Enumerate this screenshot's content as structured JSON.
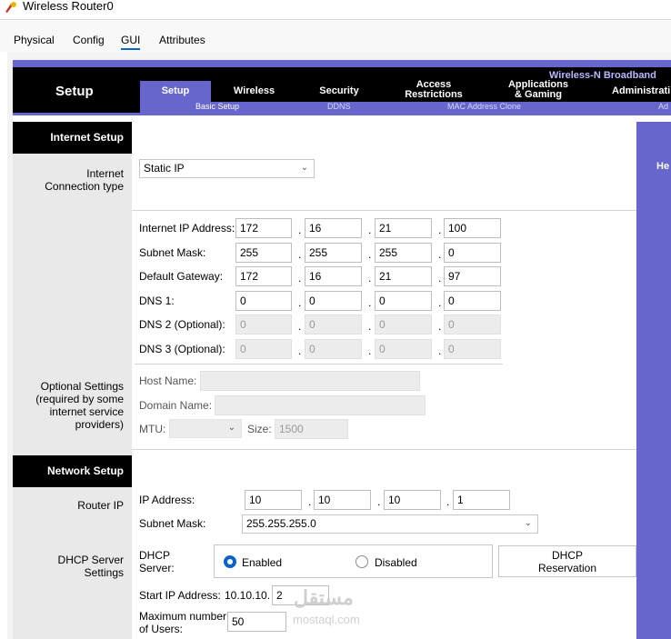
{
  "window": {
    "title": "Wireless Router0"
  },
  "top_tabs": [
    "Physical",
    "Config",
    "GUI",
    "Attributes"
  ],
  "header": {
    "brand": "Wireless-N Broadband",
    "section_title": "Setup",
    "nav": {
      "setup": "Setup",
      "wireless": "Wireless",
      "security": "Security",
      "access_1": "Access",
      "access_2": "Restrictions",
      "apps_1": "Applications",
      "apps_2": "& Gaming",
      "admin": "Administrati"
    },
    "subnav": {
      "basic": "Basic Setup",
      "ddns": "DDNS",
      "mac": "MAC Address Clone",
      "ad": "Ad"
    }
  },
  "help_label": "He",
  "internet_setup": {
    "section": "Internet Setup",
    "conn_label_1": "Internet",
    "conn_label_2": "Connection type",
    "conn_type": "Static IP",
    "ip_label": "Internet IP Address:",
    "ip": [
      "172",
      "16",
      "21",
      "100"
    ],
    "mask_label": "Subnet Mask:",
    "mask": [
      "255",
      "255",
      "255",
      "0"
    ],
    "gw_label": "Default Gateway:",
    "gw": [
      "172",
      "16",
      "21",
      "97"
    ],
    "dns1_label": "DNS 1:",
    "dns1": [
      "0",
      "0",
      "0",
      "0"
    ],
    "dns2_label": "DNS 2 (Optional):",
    "dns2": [
      "0",
      "0",
      "0",
      "0"
    ],
    "dns3_label": "DNS 3 (Optional):",
    "dns3": [
      "0",
      "0",
      "0",
      "0"
    ],
    "opt_1": "Optional Settings",
    "opt_2": "(required by some",
    "opt_3": "internet service",
    "opt_4": "providers)",
    "host_label": "Host Name:",
    "domain_label": "Domain Name:",
    "mtu_label": "MTU:",
    "size_label": "Size:",
    "size_value": "1500"
  },
  "network_setup": {
    "section": "Network Setup",
    "router_ip_label": "Router IP",
    "ip_label": "IP Address:",
    "ip": [
      "10",
      "10",
      "10",
      "1"
    ],
    "mask_label": "Subnet Mask:",
    "mask": "255.255.255.0",
    "dhcp_l1": "DHCP Server",
    "dhcp_l2": "Settings",
    "dhcp_server_1": "DHCP",
    "dhcp_server_2": "Server:",
    "enabled": "Enabled",
    "disabled": "Disabled",
    "reservation_1": "DHCP",
    "reservation_2": "Reservation",
    "start_label": "Start IP Address:",
    "start_prefix": "10.10.10.",
    "start_value": "2",
    "max_1": "Maximum number",
    "max_2": "of Users:",
    "max_value": "50"
  },
  "watermark": {
    "arabic": "مستقل",
    "site": "mostaql.com"
  }
}
